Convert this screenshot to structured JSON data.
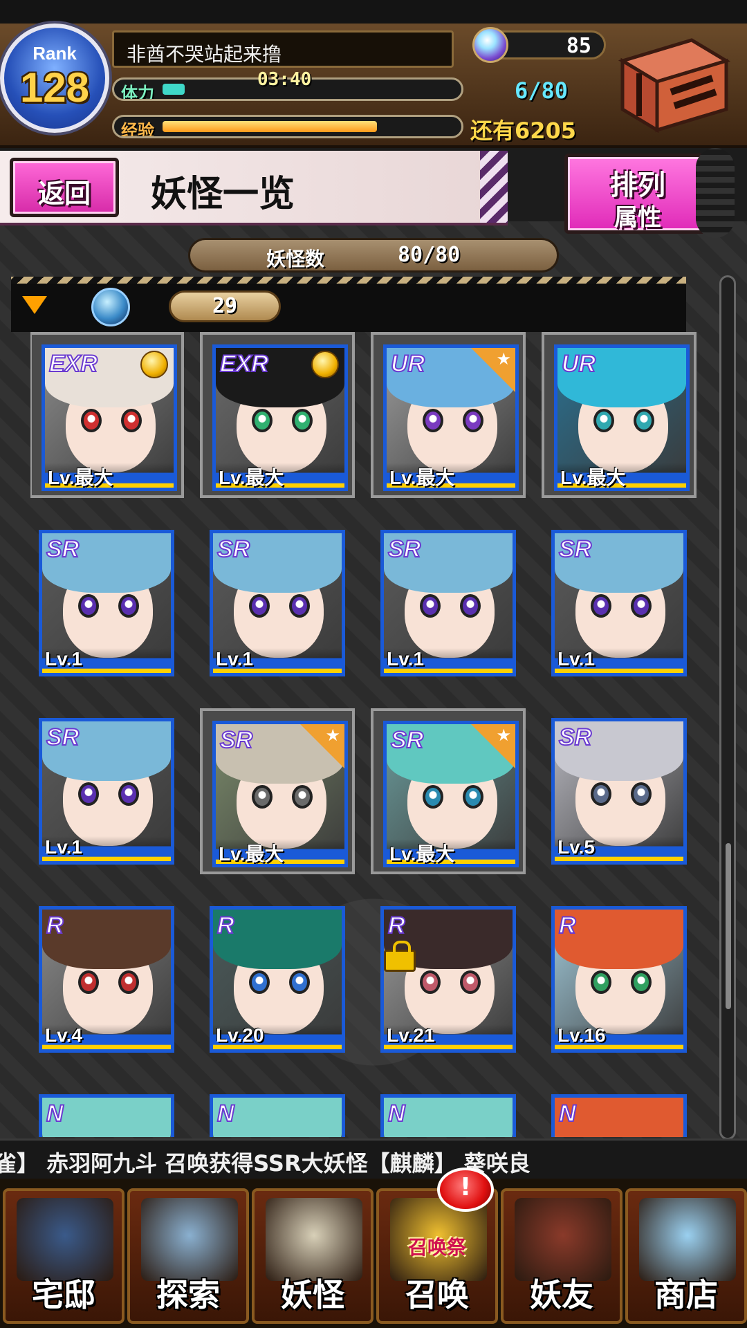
{
  "header": {
    "rank_label": "Rank",
    "rank_value": "128",
    "player_name": "非酋不哭站起来撸",
    "stamina_label": "体力",
    "stamina_timer": "03:40",
    "stamina_count": "6/80",
    "stamina_fill_fraction": 0.075,
    "exp_label": "经验",
    "exp_remaining": "还有6205",
    "exp_fill_fraction": 0.72,
    "gem_count": "85"
  },
  "title_bar": {
    "back_label": "返回",
    "title": "妖怪一览",
    "sort_label": "排列",
    "sort_value": "属性"
  },
  "count_bar": {
    "label": "妖怪数",
    "value": "80/80"
  },
  "filter": {
    "element_count": "29"
  },
  "cards": [
    {
      "rarity": "EXR",
      "level": "Lv.最大",
      "framed": true,
      "badge": "medal",
      "hair": "#e8e0d8",
      "eye": "#d03030",
      "bg": "#8a8a8a"
    },
    {
      "rarity": "EXR",
      "level": "Lv.最大",
      "framed": true,
      "badge": "medal",
      "hair": "#1a1a1a",
      "eye": "#30b070",
      "bg": "#6a6a6a"
    },
    {
      "rarity": "UR",
      "level": "Lv.最大",
      "framed": true,
      "badge": "star",
      "hair": "#6ab0e0",
      "eye": "#7a3ac0",
      "bg": "#9a9a9a"
    },
    {
      "rarity": "UR",
      "level": "Lv.最大",
      "framed": true,
      "badge": "none",
      "hair": "#30b8d8",
      "eye": "#30a8b0",
      "bg": "#2a7090"
    },
    {
      "rarity": "SR",
      "level": "Lv.1",
      "framed": false,
      "badge": "none",
      "hair": "#7ab8d8",
      "eye": "#5a30b0",
      "bg": "#5a5a5a"
    },
    {
      "rarity": "SR",
      "level": "Lv.1",
      "framed": false,
      "badge": "none",
      "hair": "#7ab8d8",
      "eye": "#5a30b0",
      "bg": "#5a5a5a"
    },
    {
      "rarity": "SR",
      "level": "Lv.1",
      "framed": false,
      "badge": "none",
      "hair": "#7ab8d8",
      "eye": "#5a30b0",
      "bg": "#5a5a5a"
    },
    {
      "rarity": "SR",
      "level": "Lv.1",
      "framed": false,
      "badge": "none",
      "hair": "#7ab8d8",
      "eye": "#5a30b0",
      "bg": "#5a5a5a"
    },
    {
      "rarity": "SR",
      "level": "Lv.1",
      "framed": false,
      "badge": "none",
      "hair": "#7ab8d8",
      "eye": "#5a30b0",
      "bg": "#5a5a5a"
    },
    {
      "rarity": "SR",
      "level": "Lv.最大",
      "framed": true,
      "badge": "star",
      "hair": "#c8c0b0",
      "eye": "#6a6a6a",
      "bg": "#7a8a6a"
    },
    {
      "rarity": "SR",
      "level": "Lv.最大",
      "framed": true,
      "badge": "star",
      "hair": "#60c8c0",
      "eye": "#2a8ab0",
      "bg": "#6a9a9a"
    },
    {
      "rarity": "SR",
      "level": "Lv.5",
      "framed": false,
      "badge": "none",
      "hair": "#c8c8d0",
      "eye": "#5a6a8a",
      "bg": "#b8b8c0"
    },
    {
      "rarity": "R",
      "level": "Lv.4",
      "framed": false,
      "badge": "none",
      "hair": "#5a3a2a",
      "eye": "#c03030",
      "bg": "#8a8a8a"
    },
    {
      "rarity": "R",
      "level": "Lv.20",
      "framed": false,
      "badge": "none",
      "hair": "#1a7a6a",
      "eye": "#3070d0",
      "bg": "#4a5a5a"
    },
    {
      "rarity": "R",
      "level": "Lv.21",
      "framed": false,
      "badge": "lock",
      "hair": "#3a2a2a",
      "eye": "#c05a6a",
      "bg": "#9a9a9a"
    },
    {
      "rarity": "R",
      "level": "Lv.16",
      "framed": false,
      "badge": "none",
      "hair": "#e05a30",
      "eye": "#30a060",
      "bg": "#a0c8d8"
    },
    {
      "rarity": "N",
      "level": "",
      "framed": false,
      "badge": "none",
      "hair": "#7ad0c8",
      "eye": "#3a8ab0",
      "bg": "#5a6a6a"
    },
    {
      "rarity": "N",
      "level": "",
      "framed": false,
      "badge": "none",
      "hair": "#7ad0c8",
      "eye": "#3a8ab0",
      "bg": "#5a6a6a"
    },
    {
      "rarity": "N",
      "level": "",
      "framed": false,
      "badge": "none",
      "hair": "#7ad0c8",
      "eye": "#3a8ab0",
      "bg": "#5a6a6a"
    },
    {
      "rarity": "N",
      "level": "",
      "framed": false,
      "badge": "none",
      "hair": "#e05a30",
      "eye": "#30a060",
      "bg": "#c0a060"
    }
  ],
  "ticker": {
    "text": "雀】    赤羽阿九斗 召唤获得SSR大妖怪【麒麟】    葵咲良"
  },
  "nav": [
    {
      "label": "宅邸",
      "art": "#3a5a8a",
      "icon": "house-icon"
    },
    {
      "label": "探索",
      "art": "#8ab0d0",
      "icon": "magnifier-icon"
    },
    {
      "label": "妖怪",
      "art": "#d8d0b8",
      "icon": "scroll-icon"
    },
    {
      "label": "召唤",
      "art": "#f0c030",
      "icon": "star-icon"
    },
    {
      "label": "妖友",
      "art": "#8a3a2a",
      "icon": "fox-girl-icon"
    },
    {
      "label": "商店",
      "art": "#9ad0f0",
      "icon": "orb-icon"
    }
  ],
  "summon": {
    "badge_mark": "!",
    "fest_label": "召唤祭"
  },
  "colors": {
    "accent_pink": "#e02ab8",
    "card_border_blue": "#1a5ad8",
    "gold": "#ffd24a"
  }
}
